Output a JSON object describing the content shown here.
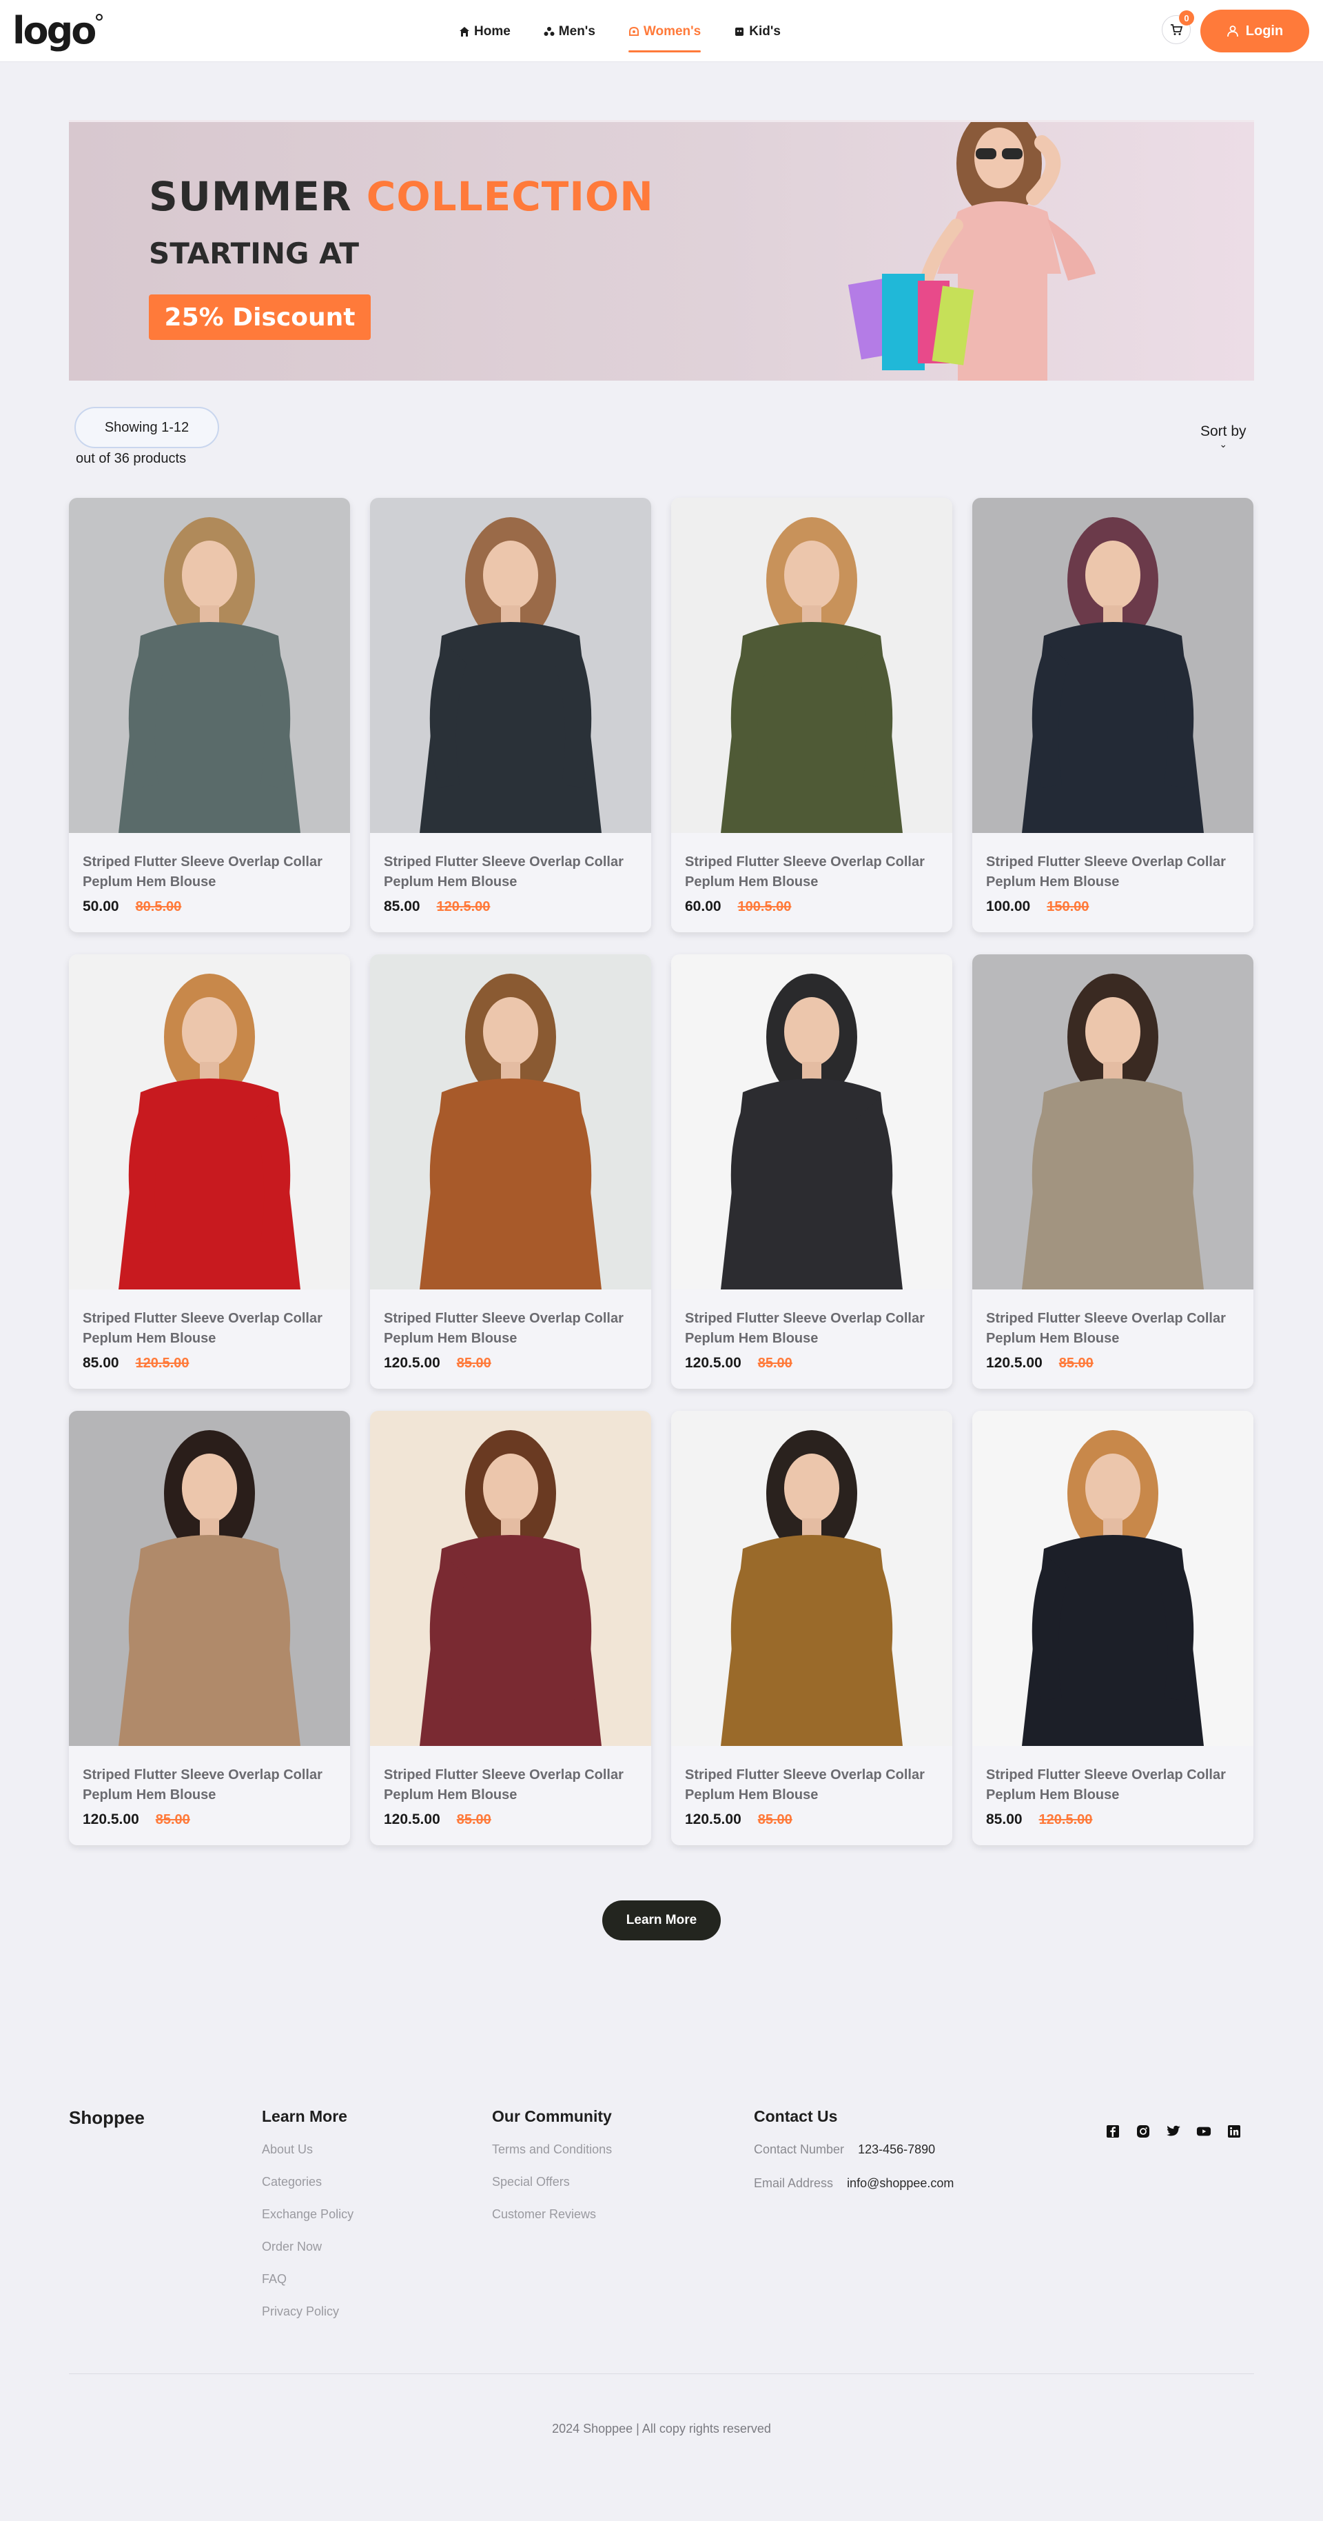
{
  "header": {
    "logo_text": "logo",
    "nav": [
      {
        "label": "Home",
        "icon": "home-icon"
      },
      {
        "label": "Men's",
        "icon": "men-icon"
      },
      {
        "label": "Women's",
        "icon": "women-icon",
        "active": true
      },
      {
        "label": "Kid's",
        "icon": "kids-icon"
      }
    ],
    "cart_count": "0",
    "login_label": "Login"
  },
  "banner": {
    "title_part1": "SUMMER",
    "title_part2": "COLLECTION",
    "subtitle": "STARTING AT",
    "discount": "25% Discount"
  },
  "listing": {
    "showing": "Showing 1-12",
    "total": "out of 36 products",
    "sort_label": "Sort by"
  },
  "products": [
    {
      "title": "Striped Flutter Sleeve Overlap Collar Peplum Hem Blouse",
      "price": "50.00",
      "old_price": "80.5.00",
      "bg": "#c3c4c6",
      "garment": "#5a6b6a",
      "hair": "#b08a5a"
    },
    {
      "title": "Striped Flutter Sleeve Overlap Collar Peplum Hem Blouse",
      "price": "85.00",
      "old_price": "120.5.00",
      "bg": "#cfd0d4",
      "garment": "#2a3138",
      "hair": "#9a6a48"
    },
    {
      "title": "Striped Flutter Sleeve Overlap Collar Peplum Hem Blouse",
      "price": "60.00",
      "old_price": "100.5.00",
      "bg": "#efefef",
      "garment": "#4f5a36",
      "hair": "#c8925a"
    },
    {
      "title": "Striped Flutter Sleeve Overlap Collar Peplum Hem Blouse",
      "price": "100.00",
      "old_price": "150.00",
      "bg": "#b6b6b8",
      "garment": "#232a36",
      "hair": "#6b3a4a"
    },
    {
      "title": "Striped Flutter Sleeve Overlap Collar Peplum Hem Blouse",
      "price": "85.00",
      "old_price": "120.5.00",
      "bg": "#f2f2f2",
      "garment": "#c81a1f",
      "hair": "#c8884a"
    },
    {
      "title": "Striped Flutter Sleeve Overlap Collar Peplum Hem Blouse",
      "price": "120.5.00",
      "old_price": "85.00",
      "bg": "#e4e7e6",
      "garment": "#a85a2a",
      "hair": "#8a5a32"
    },
    {
      "title": "Striped Flutter Sleeve Overlap Collar Peplum Hem Blouse",
      "price": "120.5.00",
      "old_price": "85.00",
      "bg": "#f5f5f5",
      "garment": "#2c2c30",
      "hair": "#2a2a2c"
    },
    {
      "title": "Striped Flutter Sleeve Overlap Collar Peplum Hem Blouse",
      "price": "120.5.00",
      "old_price": "85.00",
      "bg": "#b9b9bb",
      "garment": "#a29480",
      "hair": "#3a2a22"
    },
    {
      "title": "Striped Flutter Sleeve Overlap Collar Peplum Hem Blouse",
      "price": "120.5.00",
      "old_price": "85.00",
      "bg": "#b5b5b7",
      "garment": "#b08a6a",
      "hair": "#2a1e1a"
    },
    {
      "title": "Striped Flutter Sleeve Overlap Collar Peplum Hem Blouse",
      "price": "120.5.00",
      "old_price": "85.00",
      "bg": "#f1e5d6",
      "garment": "#7a2a32",
      "hair": "#6a3a22"
    },
    {
      "title": "Striped Flutter Sleeve Overlap Collar Peplum Hem Blouse",
      "price": "120.5.00",
      "old_price": "85.00",
      "bg": "#f3f3f3",
      "garment": "#9a6a2a",
      "hair": "#2a221e"
    },
    {
      "title": "Striped Flutter Sleeve Overlap Collar Peplum Hem Blouse",
      "price": "85.00",
      "old_price": "120.5.00",
      "bg": "#f6f6f6",
      "garment": "#1c1f28",
      "hair": "#c8884a"
    }
  ],
  "learn_more": "Learn More",
  "footer": {
    "brand": "Shoppee",
    "learn_more": {
      "heading": "Learn More",
      "links": [
        "About Us",
        "Categories",
        "Exchange Policy",
        "Order Now",
        "FAQ",
        "Privacy Policy"
      ]
    },
    "community": {
      "heading": "Our Community",
      "links": [
        "Terms and Conditions",
        "Special Offers",
        "Customer Reviews"
      ]
    },
    "contact": {
      "heading": "Contact Us",
      "phone_label": "Contact Number",
      "phone": "123-456-7890",
      "email_label": "Email Address",
      "email": "info@shoppee.com"
    },
    "socials": [
      "facebook-icon",
      "instagram-icon",
      "twitter-icon",
      "youtube-icon",
      "linkedin-icon"
    ],
    "copyright": "2024 Shoppee | All copy rights reserved"
  },
  "colors": {
    "accent": "#ff7a3a",
    "dark_button": "#23251f",
    "page_bg": "#f0f0f5"
  }
}
